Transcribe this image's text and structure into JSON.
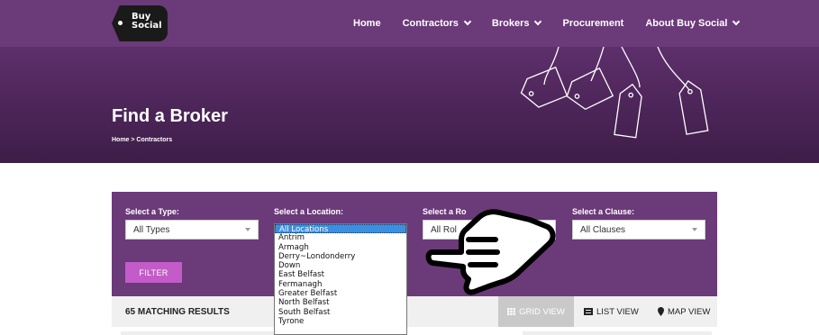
{
  "nav": {
    "logo_text_1": "Buy",
    "logo_text_2": "Social",
    "items": [
      {
        "label": "Home",
        "has_dropdown": false
      },
      {
        "label": "Contractors",
        "has_dropdown": true
      },
      {
        "label": "Brokers",
        "has_dropdown": true
      },
      {
        "label": "Procurement",
        "has_dropdown": false
      },
      {
        "label": "About Buy Social",
        "has_dropdown": true
      }
    ]
  },
  "hero": {
    "title": "Find a Broker",
    "breadcrumb": "Home  >  Contractors"
  },
  "filters": {
    "type_label": "Select a Type:",
    "type_value": "All Types",
    "location_label": "Select a Location:",
    "role_label": "Select a Ro",
    "role_value": "All Rol",
    "clause_label": "Select a Clause:",
    "clause_value": "All Clauses",
    "filter_button": "FILTER"
  },
  "location_dropdown": {
    "selected": "All Locations",
    "options": [
      "All Locations",
      "Antrim",
      "Armagh",
      "Derry~Londonderry",
      "Down",
      "East Belfast",
      "Fermanagh",
      "Greater Belfast",
      "North Belfast",
      "South Belfast",
      "Tyrone"
    ]
  },
  "results": {
    "count_text": "65 MATCHING RESULTS",
    "grid_view": "GRID VIEW",
    "list_view": "LIST VIEW",
    "map_view": "MAP VIEW"
  },
  "colors": {
    "brand_purple": "#6b3a79",
    "hero_purple": "#4a2456",
    "filter_button": "#c35bc9",
    "dropdown_highlight": "#3d8ee0"
  }
}
